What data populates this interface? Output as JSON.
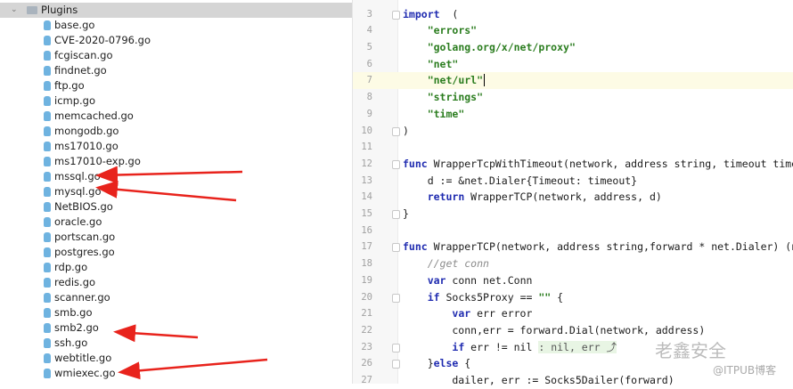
{
  "tree": {
    "folder": "Plugins",
    "files": [
      "base.go",
      "CVE-2020-0796.go",
      "fcgiscan.go",
      "findnet.go",
      "ftp.go",
      "icmp.go",
      "memcached.go",
      "mongodb.go",
      "ms17010.go",
      "ms17010-exp.go",
      "mssql.go",
      "mysql.go",
      "NetBIOS.go",
      "oracle.go",
      "portscan.go",
      "postgres.go",
      "rdp.go",
      "redis.go",
      "scanner.go",
      "smb.go",
      "smb2.go",
      "ssh.go",
      "webtitle.go",
      "wmiexec.go"
    ]
  },
  "editor": {
    "current_line": "7",
    "lines": [
      {
        "n": "3",
        "parts": [
          [
            "kw",
            "import"
          ],
          [
            "",
            "  ("
          ]
        ]
      },
      {
        "n": "4",
        "parts": [
          [
            "",
            "    "
          ],
          [
            "str",
            "\"errors\""
          ]
        ]
      },
      {
        "n": "5",
        "parts": [
          [
            "",
            "    "
          ],
          [
            "str",
            "\"golang.org/x/net/proxy\""
          ]
        ]
      },
      {
        "n": "6",
        "parts": [
          [
            "",
            "    "
          ],
          [
            "str",
            "\"net\""
          ]
        ]
      },
      {
        "n": "7",
        "parts": [
          [
            "",
            "    "
          ],
          [
            "str",
            "\"net/url\""
          ]
        ]
      },
      {
        "n": "8",
        "parts": [
          [
            "",
            "    "
          ],
          [
            "str",
            "\"strings\""
          ]
        ]
      },
      {
        "n": "9",
        "parts": [
          [
            "",
            "    "
          ],
          [
            "str",
            "\"time\""
          ]
        ]
      },
      {
        "n": "10",
        "parts": [
          [
            "",
            ")"
          ]
        ]
      },
      {
        "n": "11",
        "parts": []
      },
      {
        "n": "12",
        "parts": [
          [
            "kw",
            "func"
          ],
          [
            "",
            " WrapperTcpWithTimeout(network, address string, timeout time."
          ]
        ]
      },
      {
        "n": "13",
        "parts": [
          [
            "",
            "    d := &net.Dialer{Timeout: timeout}"
          ]
        ]
      },
      {
        "n": "14",
        "parts": [
          [
            "",
            "    "
          ],
          [
            "kw",
            "return"
          ],
          [
            "",
            " WrapperTCP(network, address, d)"
          ]
        ]
      },
      {
        "n": "15",
        "parts": [
          [
            "",
            "}"
          ]
        ]
      },
      {
        "n": "16",
        "parts": []
      },
      {
        "n": "17",
        "parts": [
          [
            "kw",
            "func"
          ],
          [
            "",
            " WrapperTCP(network, address string,forward * net.Dialer) (ne"
          ]
        ]
      },
      {
        "n": "18",
        "parts": [
          [
            "",
            "    "
          ],
          [
            "cm",
            "//get conn"
          ]
        ]
      },
      {
        "n": "19",
        "parts": [
          [
            "",
            "    "
          ],
          [
            "kw",
            "var"
          ],
          [
            "",
            " conn net.Conn"
          ]
        ]
      },
      {
        "n": "20",
        "parts": [
          [
            "",
            "    "
          ],
          [
            "kw",
            "if"
          ],
          [
            "",
            " Socks5Proxy == "
          ],
          [
            "str",
            "\"\""
          ],
          [
            "",
            " {"
          ]
        ]
      },
      {
        "n": "21",
        "parts": [
          [
            "",
            "        "
          ],
          [
            "kw",
            "var"
          ],
          [
            "",
            " err error"
          ]
        ]
      },
      {
        "n": "22",
        "parts": [
          [
            "",
            "        conn,err = forward.Dial(network, address)"
          ]
        ]
      },
      {
        "n": "23",
        "parts": [
          [
            "",
            "        "
          ],
          [
            "kw",
            "if"
          ],
          [
            "",
            " err != nil "
          ],
          [
            "hint",
            ": nil, err ⤴"
          ]
        ]
      },
      {
        "n": "26",
        "parts": [
          [
            "",
            "    }"
          ],
          [
            "kw",
            "else"
          ],
          [
            "",
            " {"
          ]
        ]
      },
      {
        "n": "27",
        "parts": [
          [
            "",
            "        dailer, err := Socks5Dailer(forward)"
          ]
        ]
      }
    ]
  },
  "watermark": {
    "brand": "老鑫安全",
    "source": "@ITPUB博客"
  },
  "colors": {
    "arrow": "#e8231c"
  }
}
